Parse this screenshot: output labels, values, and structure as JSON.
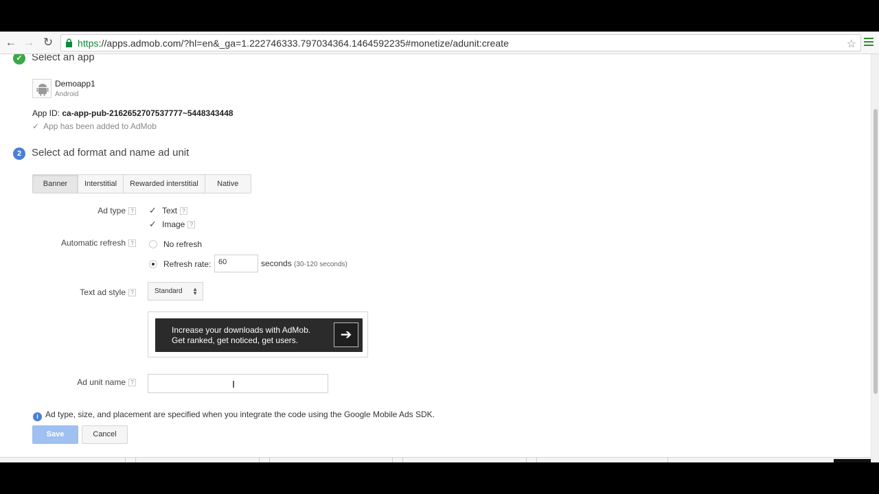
{
  "browser": {
    "url_scheme": "https",
    "url_rest": "://apps.admob.com/?hl=en&_ga=1.222746333.797034364.1464592235#monetize/adunit:create"
  },
  "step1": {
    "badge": "✓",
    "title": "Select an app",
    "app_name": "Demoapp1",
    "app_platform": "Android",
    "app_id_label": "App ID:",
    "app_id_value": "ca-app-pub-2162652707537777~5448343448",
    "added_text": "App has been added to AdMob"
  },
  "step2": {
    "badge": "2",
    "title": "Select ad format and name ad unit",
    "tabs": [
      {
        "label": "Banner",
        "active": true
      },
      {
        "label": "Interstitial",
        "active": false
      },
      {
        "label": "Rewarded interstitial",
        "active": false
      },
      {
        "label": "Native",
        "active": false
      }
    ]
  },
  "form": {
    "ad_type_label": "Ad type",
    "ad_type_text": "Text",
    "ad_type_image": "Image",
    "auto_refresh_label": "Automatic refresh",
    "no_refresh": "No refresh",
    "refresh_rate": "Refresh rate:",
    "refresh_value": "60",
    "seconds": "seconds",
    "seconds_range": "(30-120 seconds)",
    "text_ad_style_label": "Text ad style",
    "text_ad_style_value": "Standard",
    "preview_line1": "Increase your downloads with AdMob.",
    "preview_line2": "Get ranked, get noticed, get users.",
    "ad_unit_name_label": "Ad unit name",
    "ad_unit_name_value": "",
    "help": "?"
  },
  "info_text": "Ad type, size, and placement are specified when you integrate the code using the Google Mobile Ads SDK.",
  "buttons": {
    "save": "Save",
    "cancel": "Cancel"
  },
  "colors": {
    "step_done": "#3aa845",
    "step_active": "#4a7fd4"
  }
}
